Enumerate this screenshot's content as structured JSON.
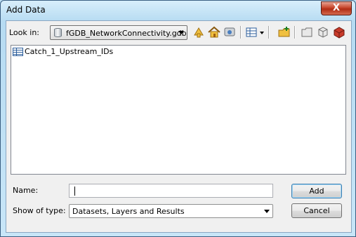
{
  "window": {
    "title": "Add Data",
    "close_label": "X"
  },
  "lookin": {
    "label": "Look in:",
    "value": "fGDB_NetworkConnectivity.gdb"
  },
  "toolbar": {
    "icons": [
      "up-one-level-icon",
      "home-icon",
      "connect-folder-icon",
      "view-list-icon",
      "new-folder-icon",
      "folder-icon",
      "properties-icon",
      "toolbox-icon"
    ]
  },
  "files": [
    {
      "name": "Catch_1_Upstream_IDs",
      "icon": "table-icon"
    }
  ],
  "name_field": {
    "label": "Name:",
    "value": ""
  },
  "type_field": {
    "label": "Show of type:",
    "value": "Datasets, Layers and Results"
  },
  "buttons": {
    "add": "Add",
    "cancel": "Cancel"
  }
}
